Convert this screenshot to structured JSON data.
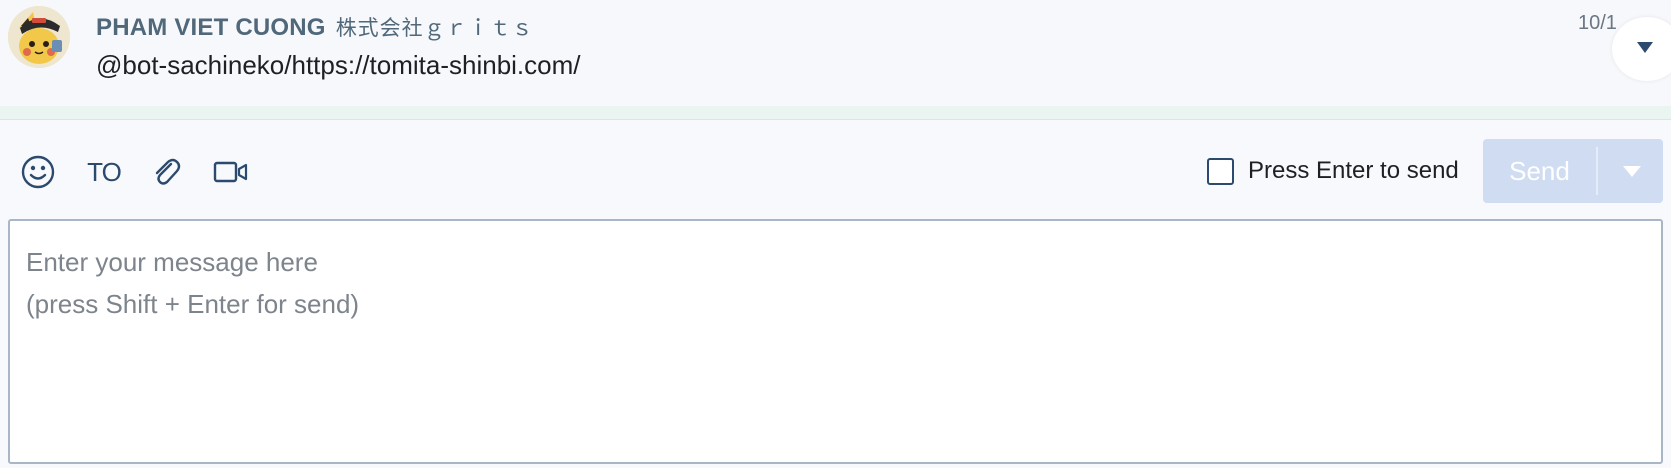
{
  "message": {
    "sender_name": "PHAM VIET CUONG",
    "sender_org": "株式会社ｇｒｉｔｓ",
    "text": "@bot-sachineko/https://tomita-shinbi.com/",
    "timestamp": "10/1",
    "avatar_icon": "cartoon-character-avatar",
    "menu_icon": "caret-down-icon"
  },
  "toolbar": {
    "emoji_icon": "smile-icon",
    "to_label": "TO",
    "attach_icon": "paperclip-icon",
    "video_icon": "video-camera-icon",
    "enter_to_send_label": "Press Enter to send",
    "enter_to_send_checked": false,
    "send_label": "Send",
    "send_enabled": false
  },
  "composer": {
    "placeholder": "Enter your message here\n(press Shift + Enter for send)",
    "value": ""
  },
  "colors": {
    "accent": "#2c4a6e",
    "sender": "#50687a",
    "send_disabled_bg": "#cfdcf2",
    "stripe": "#eaf5f1"
  }
}
